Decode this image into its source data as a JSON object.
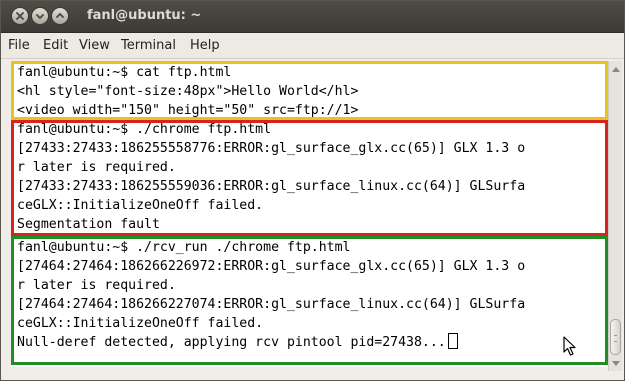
{
  "window": {
    "title": "fanl@ubuntu: ~"
  },
  "menu": [
    {
      "label": "File"
    },
    {
      "label": "Edit"
    },
    {
      "label": "View"
    },
    {
      "label": "Terminal"
    },
    {
      "label": "Help"
    }
  ],
  "terminal": {
    "lines": [
      "fanl@ubuntu:~$ cat ftp.html",
      "<hl style=\"font-size:48px\">Hello World</hl>",
      "<video width=\"150\" height=\"50\" src=ftp://1>",
      "fanl@ubuntu:~$ ./chrome ftp.html",
      "[27433:27433:186255558776:ERROR:gl_surface_glx.cc(65)] GLX 1.3 o",
      "r later is required.",
      "[27433:27433:186255559036:ERROR:gl_surface_linux.cc(64)] GLSurfa",
      "ceGLX::InitializeOneOff failed.",
      "Segmentation fault",
      "fanl@ubuntu:~$ ./rcv_run ./chrome ftp.html",
      "[27464:27464:186266226972:ERROR:gl_surface_glx.cc(65)] GLX 1.3 o",
      "r later is required.",
      "[27464:27464:186266227074:ERROR:gl_surface_linux.cc(64)] GLSurfa",
      "ceGLX::InitializeOneOff failed.",
      "Null-deref detected, applying rcv pintool pid=27438..."
    ]
  },
  "highlights": [
    {
      "name": "yellow-highlight",
      "color": "#e8c21e"
    },
    {
      "name": "red-highlight",
      "color": "#d8231e"
    },
    {
      "name": "green-highlight",
      "color": "#1f8f23"
    }
  ]
}
